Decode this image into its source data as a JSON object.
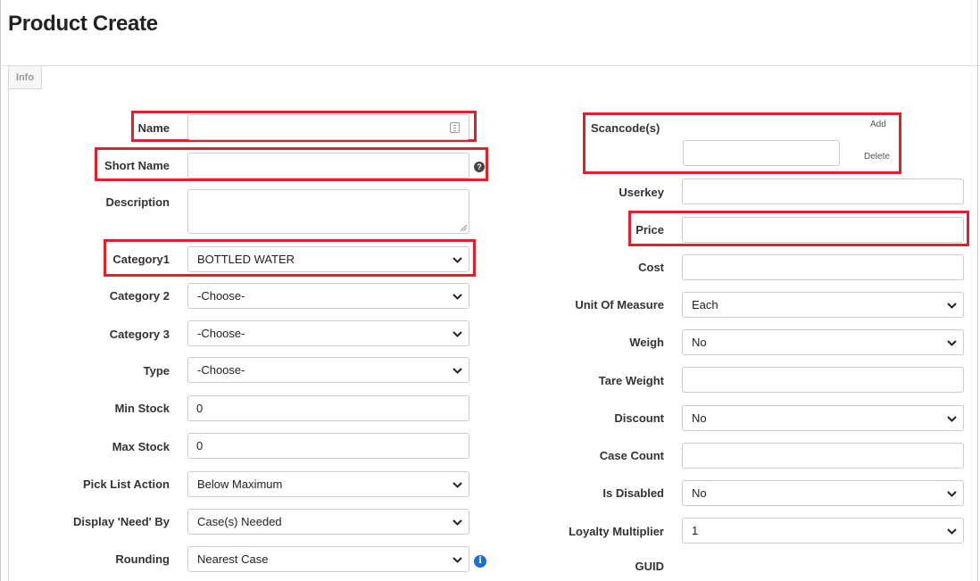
{
  "page": {
    "title": "Product Create"
  },
  "tabs": [
    {
      "label": "Info"
    }
  ],
  "colors": {
    "highlight": "#e0202b",
    "info_icon": "#1a6fd6"
  },
  "left": {
    "name": {
      "label": "Name",
      "value": ""
    },
    "short_name": {
      "label": "Short Name",
      "value": ""
    },
    "description": {
      "label": "Description",
      "value": ""
    },
    "category1": {
      "label": "Category1",
      "value": "BOTTLED WATER"
    },
    "category2": {
      "label": "Category 2",
      "value": "-Choose-"
    },
    "category3": {
      "label": "Category 3",
      "value": "-Choose-"
    },
    "type": {
      "label": "Type",
      "value": "-Choose-"
    },
    "min_stock": {
      "label": "Min Stock",
      "value": "0"
    },
    "max_stock": {
      "label": "Max Stock",
      "value": "0"
    },
    "pick_list_action": {
      "label": "Pick List Action",
      "value": "Below Maximum"
    },
    "display_need_by": {
      "label": "Display 'Need' By",
      "value": "Case(s) Needed"
    },
    "rounding": {
      "label": "Rounding",
      "value": "Nearest Case"
    }
  },
  "right": {
    "scancodes": {
      "label": "Scancode(s)",
      "value": "",
      "add_label": "Add",
      "delete_label": "Delete"
    },
    "userkey": {
      "label": "Userkey",
      "value": ""
    },
    "price": {
      "label": "Price",
      "value": ""
    },
    "cost": {
      "label": "Cost",
      "value": ""
    },
    "unit_of_measure": {
      "label": "Unit Of Measure",
      "value": "Each"
    },
    "weigh": {
      "label": "Weigh",
      "value": "No"
    },
    "tare_weight": {
      "label": "Tare Weight",
      "value": ""
    },
    "discount": {
      "label": "Discount",
      "value": "No"
    },
    "case_count": {
      "label": "Case Count",
      "value": ""
    },
    "is_disabled": {
      "label": "Is Disabled",
      "value": "No"
    },
    "loyalty_multiplier": {
      "label": "Loyalty Multiplier",
      "value": "1"
    },
    "guid": {
      "label": "GUID"
    }
  },
  "icons": {
    "help": "question-icon",
    "info": "info-icon",
    "keyboard": "keyboard-icon",
    "dropdown": "chevron-down-icon"
  }
}
